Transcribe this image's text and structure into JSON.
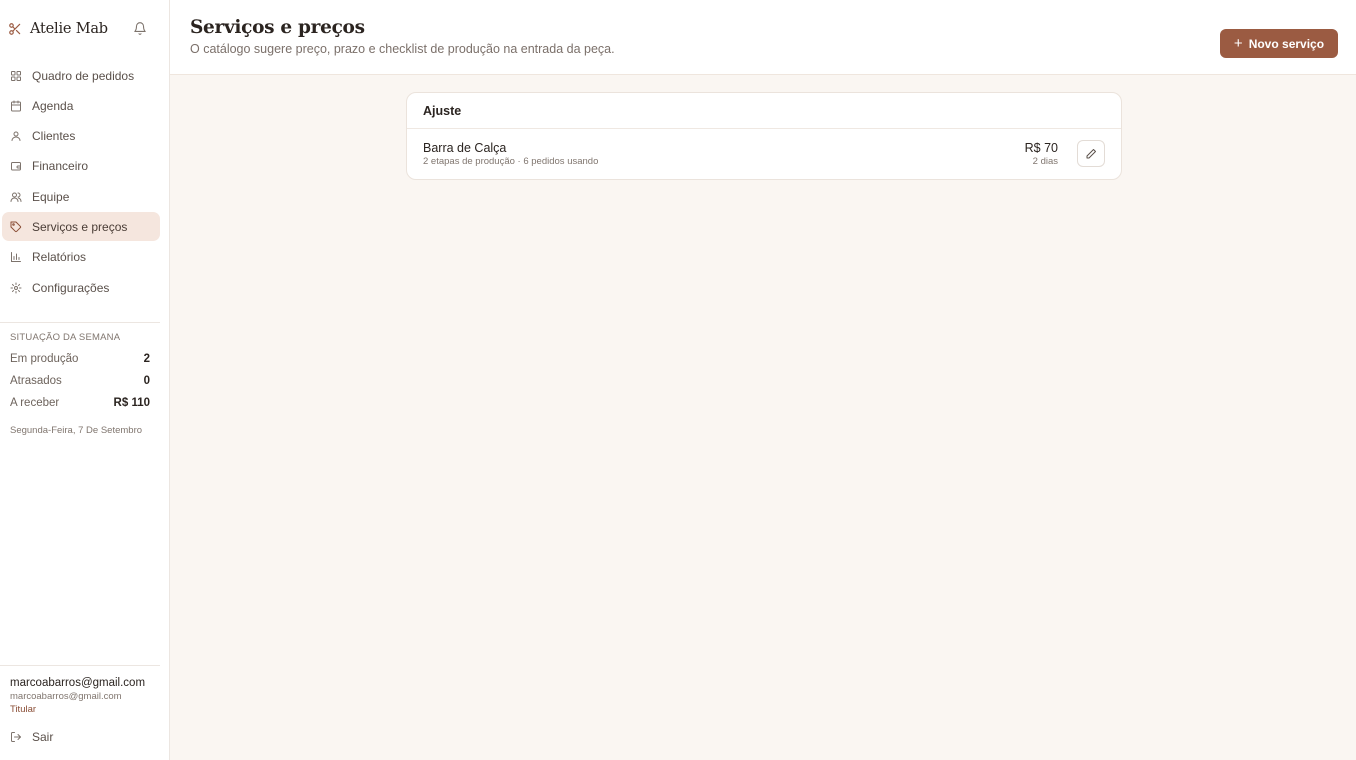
{
  "app": {
    "name": "Atelie Mab"
  },
  "colors": {
    "accent": "#9b5b42",
    "active_bg": "#f5e6de",
    "background": "#faf6f2"
  },
  "sidebar": {
    "items": [
      {
        "label": "Quadro de pedidos",
        "icon": "grid-icon"
      },
      {
        "label": "Agenda",
        "icon": "calendar-icon"
      },
      {
        "label": "Clientes",
        "icon": "user-icon"
      },
      {
        "label": "Financeiro",
        "icon": "wallet-icon"
      },
      {
        "label": "Equipe",
        "icon": "users-icon"
      },
      {
        "label": "Serviços e preços",
        "icon": "tag-icon",
        "active": true
      },
      {
        "label": "Relatórios",
        "icon": "bar-chart-icon"
      },
      {
        "label": "Configurações",
        "icon": "gear-icon"
      }
    ],
    "week": {
      "title": "SITUAÇÃO DA SEMANA",
      "rows": [
        {
          "label": "Em produção",
          "value": "2"
        },
        {
          "label": "Atrasados",
          "value": "0"
        },
        {
          "label": "A receber",
          "value": "R$ 110"
        }
      ],
      "date": "Segunda-Feira, 7 De Setembro"
    },
    "user": {
      "name": "marcoabarros@gmail.com",
      "email": "marcoabarros@gmail.com",
      "role": "Titular"
    },
    "logout_label": "Sair"
  },
  "header": {
    "title": "Serviços e preços",
    "subtitle": "O catálogo sugere preço, prazo e checklist de produção na entrada da peça.",
    "new_button_label": "Novo serviço"
  },
  "catalog": {
    "category": "Ajuste",
    "services": [
      {
        "name": "Barra de Calça",
        "meta": "2 etapas de produção · 6 pedidos usando",
        "price": "R$ 70",
        "days": "2 dias"
      }
    ]
  }
}
